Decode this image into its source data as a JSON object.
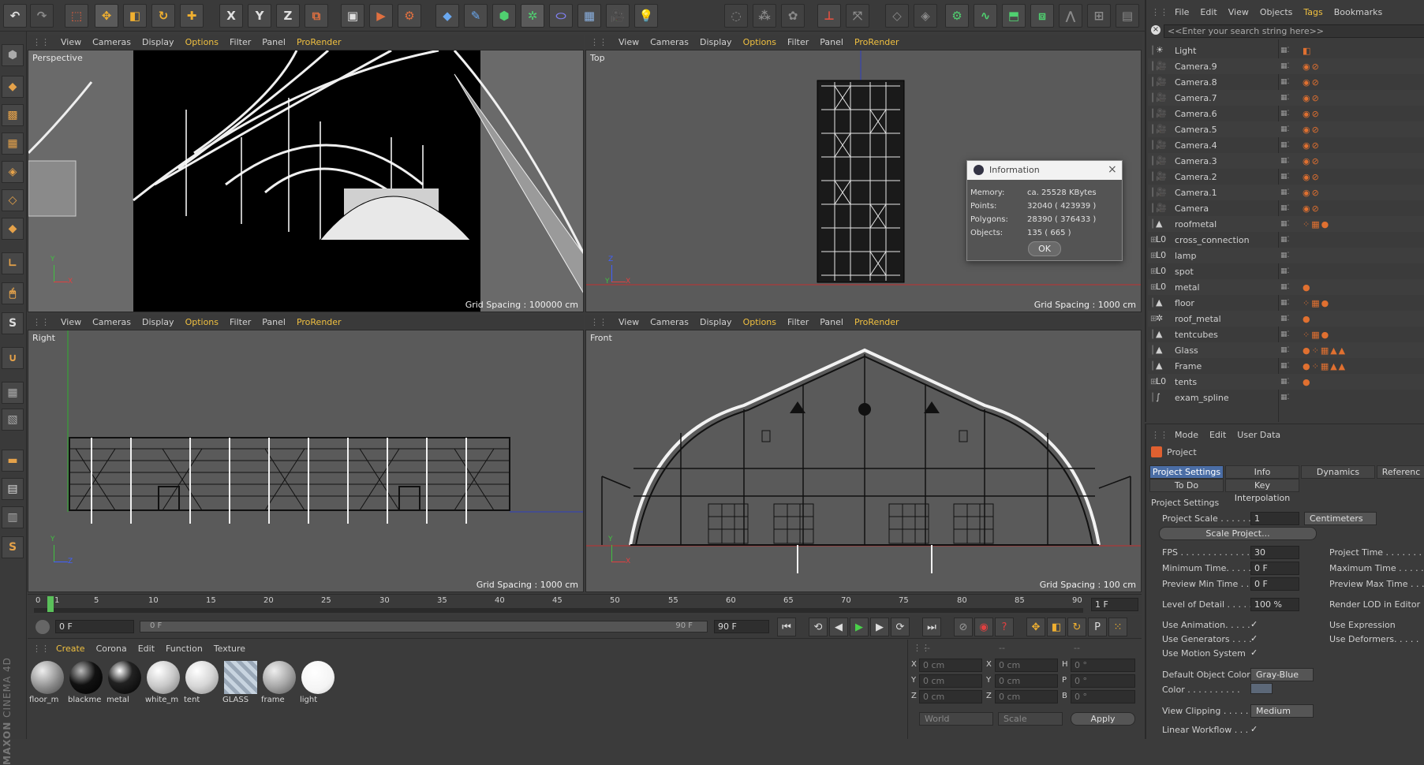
{
  "app": {
    "name": "CINEMA 4D",
    "brand": "MAXON"
  },
  "toolbar": {
    "icons": [
      "undo-icon",
      "redo-icon",
      "live-selection-icon",
      "move-icon",
      "scale-icon",
      "rotate-icon",
      "add-icon",
      "x-axis-icon",
      "y-axis-icon",
      "z-axis-icon",
      "coordinate-system-icon",
      "render-view-icon",
      "render-picture-viewer-icon",
      "render-settings-icon",
      "cube-icon",
      "pen-icon",
      "subdivision-icon",
      "array-icon",
      "deformer-icon",
      "floor-icon",
      "camera-icon",
      "light-icon"
    ],
    "axis_labels": [
      "X",
      "Y",
      "Z"
    ]
  },
  "viewport_menu": [
    "View",
    "Cameras",
    "Display",
    "Options",
    "Filter",
    "Panel",
    "ProRender"
  ],
  "viewports": [
    {
      "label": "Perspective",
      "grid": "Grid Spacing : 100000 cm"
    },
    {
      "label": "Top",
      "grid": "Grid Spacing : 1000 cm"
    },
    {
      "label": "Right",
      "grid": "Grid Spacing : 1000 cm"
    },
    {
      "label": "Front",
      "grid": "Grid Spacing : 100 cm"
    }
  ],
  "info_dialog": {
    "title": "Information",
    "rows": [
      {
        "label": "Memory:",
        "value": "ca. 25528 KBytes"
      },
      {
        "label": "Points:",
        "value": "32040 ( 423939 )"
      },
      {
        "label": "Polygons:",
        "value": "28390 ( 376433 )"
      },
      {
        "label": "Objects:",
        "value": "135 ( 665 )"
      }
    ],
    "ok": "OK"
  },
  "timeline": {
    "ticks": [
      "0",
      "1",
      "5",
      "10",
      "15",
      "20",
      "25",
      "30",
      "35",
      "40",
      "45",
      "50",
      "55",
      "60",
      "65",
      "70",
      "75",
      "80",
      "85",
      "90"
    ],
    "current_frame": "1 F",
    "start": "0 F",
    "slider_start": "0 F",
    "slider_end": "90 F",
    "end": "90 F"
  },
  "material_menu": [
    "Create",
    "Corona",
    "Edit",
    "Function",
    "Texture"
  ],
  "materials": [
    {
      "name": "floor_m",
      "color": "#8a8a8a"
    },
    {
      "name": "blackme",
      "color": "#111111"
    },
    {
      "name": "metal",
      "color": "#1a1a1a"
    },
    {
      "name": "white_m",
      "color": "#c8c8c8"
    },
    {
      "name": "tent",
      "color": "#d6d6d6"
    },
    {
      "name": "GLASS",
      "color": "#9aa8b8"
    },
    {
      "name": "frame",
      "color": "#a8a8a8"
    },
    {
      "name": "light",
      "color": "#f4f4f4"
    }
  ],
  "coords": {
    "dashes": [
      "--",
      "--",
      "--"
    ],
    "rows": [
      {
        "a": "X",
        "av": "0 cm",
        "b": "X",
        "bv": "0 cm",
        "c": "H",
        "cv": "0 °"
      },
      {
        "a": "Y",
        "av": "0 cm",
        "b": "Y",
        "bv": "0 cm",
        "c": "P",
        "cv": "0 °"
      },
      {
        "a": "Z",
        "av": "0 cm",
        "b": "Z",
        "bv": "0 cm",
        "c": "B",
        "cv": "0 °"
      }
    ],
    "mode1": "World",
    "mode2": "Scale",
    "apply": "Apply"
  },
  "object_manager": {
    "menu": [
      "File",
      "Edit",
      "View",
      "Objects",
      "Tags",
      "Bookmarks"
    ],
    "search_placeholder": "<<Enter your search string here>>",
    "objects": [
      {
        "name": "Light",
        "icon": "light-icon"
      },
      {
        "name": "Camera.9",
        "icon": "camera-icon"
      },
      {
        "name": "Camera.8",
        "icon": "camera-icon"
      },
      {
        "name": "Camera.7",
        "icon": "camera-icon"
      },
      {
        "name": "Camera.6",
        "icon": "camera-icon"
      },
      {
        "name": "Camera.5",
        "icon": "camera-icon"
      },
      {
        "name": "Camera.4",
        "icon": "camera-icon"
      },
      {
        "name": "Camera.3",
        "icon": "camera-icon"
      },
      {
        "name": "Camera.2",
        "icon": "camera-icon"
      },
      {
        "name": "Camera.1",
        "icon": "camera-icon"
      },
      {
        "name": "Camera",
        "icon": "camera-icon"
      },
      {
        "name": "roofmetal",
        "icon": "polygon-object-icon"
      },
      {
        "name": "cross_connection",
        "icon": "null-object-icon"
      },
      {
        "name": "lamp",
        "icon": "null-object-icon"
      },
      {
        "name": "spot",
        "icon": "null-object-icon"
      },
      {
        "name": "metal",
        "icon": "null-object-icon"
      },
      {
        "name": "floor",
        "icon": "polygon-object-icon"
      },
      {
        "name": "roof_metal",
        "icon": "symmetry-icon"
      },
      {
        "name": "tentcubes",
        "icon": "polygon-object-icon"
      },
      {
        "name": "Glass",
        "icon": "polygon-object-icon"
      },
      {
        "name": "Frame",
        "icon": "polygon-object-icon"
      },
      {
        "name": "tents",
        "icon": "null-object-icon"
      },
      {
        "name": "exam_spline",
        "icon": "spline-icon"
      }
    ]
  },
  "attributes": {
    "menu": [
      "Mode",
      "Edit",
      "User Data"
    ],
    "title": "Project",
    "tabs_row1": [
      "Project Settings",
      "Info",
      "Dynamics",
      "Referenc"
    ],
    "tabs_row2": [
      "To Do",
      "Key Interpolation"
    ],
    "section": "Project Settings",
    "project_scale_label": "Project Scale . . . . . .",
    "project_scale_value": "1",
    "project_scale_unit": "Centimeters",
    "scale_project_button": "Scale Project...",
    "left_fields": [
      {
        "label": "FPS . . . . . . . . . . . . . .",
        "value": "30"
      },
      {
        "label": "Minimum Time. . . . .",
        "value": "0 F"
      },
      {
        "label": "Preview Min Time . .",
        "value": "0 F"
      },
      {
        "label": "Level of Detail . . . . .",
        "value": "100 %"
      }
    ],
    "right_fields": [
      "Project Time . . . . . . .",
      "Maximum Time . . . . .",
      "Preview Max Time . . .",
      "Render LOD in Editor"
    ],
    "left_checks": [
      "Use Animation. . . . .",
      "Use Generators . . . .",
      "Use Motion System"
    ],
    "right_checks": [
      "Use Expression",
      "Use Deformers. . . . ."
    ],
    "object_color_label": "Default Object Color",
    "object_color_value": "Gray-Blue",
    "color_label": "Color . . . . . . . . . .",
    "clipping_label": "View Clipping . . . . .",
    "clipping_value": "Medium",
    "linear_label": "Linear Workflow . . .",
    "check": "✓"
  }
}
